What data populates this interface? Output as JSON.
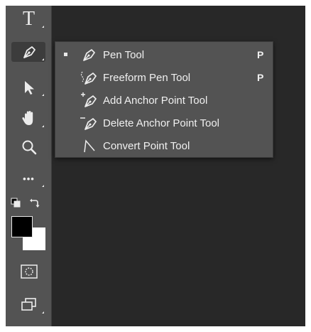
{
  "toolbar": {
    "tools": [
      {
        "name": "type-tool",
        "icon": "type-icon",
        "label": "T"
      },
      {
        "name": "pen-tool",
        "icon": "pen-icon",
        "active": true
      },
      {
        "name": "path-selection-tool",
        "icon": "arrow-selection-icon"
      },
      {
        "name": "hand-tool",
        "icon": "hand-icon"
      },
      {
        "name": "zoom-tool",
        "icon": "zoom-icon"
      },
      {
        "name": "edit-toolbar",
        "icon": "more-icon",
        "label": "•••"
      },
      {
        "name": "default-colors",
        "icon": "default-colors-icon"
      },
      {
        "name": "swap-colors",
        "icon": "swap-colors-icon"
      },
      {
        "name": "color-swatches",
        "foreground": "#000000",
        "background": "#ffffff"
      },
      {
        "name": "quick-mask",
        "icon": "quick-mask-icon"
      },
      {
        "name": "screen-mode",
        "icon": "screen-mode-icon"
      }
    ]
  },
  "pen_menu": {
    "items": [
      {
        "label": "Pen Tool",
        "shortcut": "P",
        "selected": true,
        "icon": "pen-icon"
      },
      {
        "label": "Freeform Pen Tool",
        "shortcut": "P",
        "icon": "freeform-pen-icon"
      },
      {
        "label": "Add Anchor Point Tool",
        "shortcut": "",
        "icon": "add-anchor-point-icon"
      },
      {
        "label": "Delete Anchor Point Tool",
        "shortcut": "",
        "icon": "delete-anchor-point-icon"
      },
      {
        "label": "Convert Point Tool",
        "shortcut": "",
        "icon": "convert-point-icon"
      }
    ]
  },
  "colors": {
    "toolbar_bg": "#535353",
    "canvas_bg": "#282828",
    "menu_bg": "#535353",
    "text": "#f0f0f0"
  }
}
